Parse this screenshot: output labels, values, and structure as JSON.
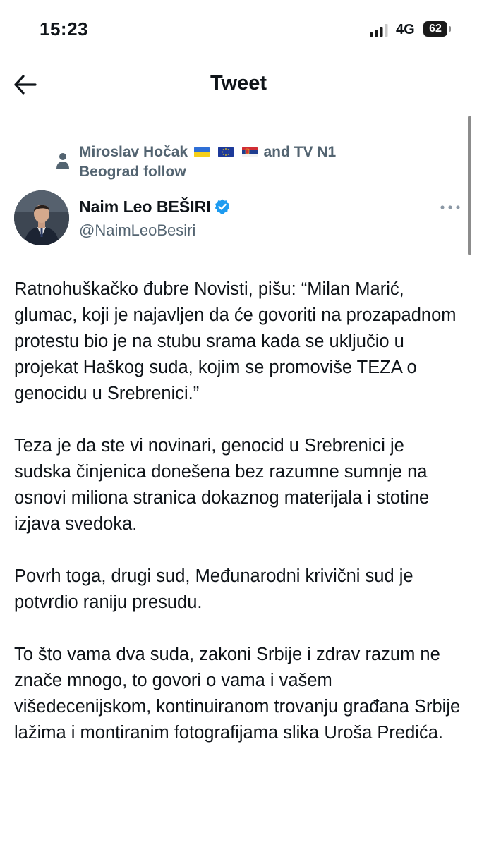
{
  "status_bar": {
    "time": "15:23",
    "network": "4G",
    "battery_level": "62",
    "icons": [
      "signal-bars-icon",
      "battery-icon"
    ]
  },
  "header": {
    "title": "Tweet",
    "back_icon": "back-arrow-icon"
  },
  "social_context": {
    "icon": "person-icon",
    "text_before_flags": "Miroslav Hočak",
    "text_after_flags": "and TV N1",
    "text_line2": "Beograd follow",
    "flags": [
      "ukraine-flag-icon",
      "eu-flag-icon",
      "serbia-flag-icon"
    ]
  },
  "author": {
    "name": "Naim Leo BEŠIRI",
    "handle": "@NaimLeoBesiri",
    "verified": true,
    "more_icon": "more-dots-icon"
  },
  "tweet": {
    "paragraphs": [
      "Ratnohuškačko đubre Novisti, pišu: “Milan Marić, glumac, koji je najavljen da će govoriti na prozapadnom protestu bio je na stubu srama kada se uključio u projekat Haškog suda, kojim se promoviše TEZA o genocidu u Srebrenici.”",
      "Teza je da ste vi novinari, genocid u Srebrenici je sudska činjenica donešena bez razumne sumnje na osnovi miliona stranica dokaznog materijala i stotine izjava svedoka.",
      "Povrh toga, drugi sud, Međunarodni krivični sud je potvrdio raniju presudu.",
      "To što vama dva suda, zakoni Srbije i zdrav razum ne znače mnogo, to govori o vama i vašem višedecenijskom, kontinuiranom trovanju građana Srbije lažima i montiranim fotografijama slika Uroša Predića."
    ]
  },
  "colors": {
    "text_primary": "#0f1419",
    "text_secondary": "#536471",
    "verified_blue": "#1d9bf0"
  }
}
